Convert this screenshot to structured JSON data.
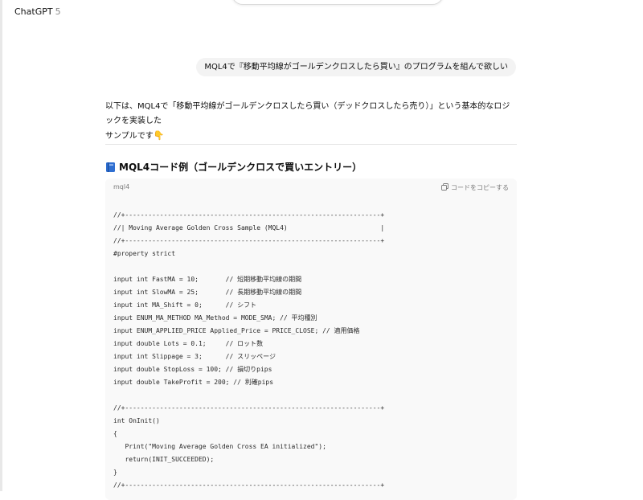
{
  "header": {
    "model_name": "ChatGPT",
    "model_version": "5"
  },
  "conversation": {
    "user_message": "MQL4で『移動平均線がゴールデンクロスしたら買い』のプログラムを組んで欲しい",
    "assistant_intro_line1": "以下は、MQL4で「移動平均線がゴールデンクロスしたら買い（デッドクロスしたら売り）」という基本的なロジックを実装した",
    "assistant_intro_line2": "サンプルです",
    "assistant_emoji": "👇",
    "section_heading": "MQL4コード例（ゴールデンクロスで買いエントリー）",
    "section_icon": "book-icon"
  },
  "code_block": {
    "language": "mql4",
    "copy_label": "コードをコピーする",
    "copy_icon": "copy-icon",
    "lines": [
      "//+------------------------------------------------------------------+",
      "//| Moving Average Golden Cross Sample (MQL4)                        |",
      "//+------------------------------------------------------------------+",
      "#property strict",
      "",
      "input int FastMA = 10;       // 短期移動平均線の期間",
      "input int SlowMA = 25;       // 長期移動平均線の期間",
      "input int MA_Shift = 0;      // シフト",
      "input ENUM_MA_METHOD MA_Method = MODE_SMA; // 平均種別",
      "input ENUM_APPLIED_PRICE Applied_Price = PRICE_CLOSE; // 適用価格",
      "input double Lots = 0.1;     // ロット数",
      "input int Slippage = 3;      // スリッページ",
      "input double StopLoss = 100; // 損切りpips",
      "input double TakeProfit = 200; // 利確pips",
      "",
      "//+------------------------------------------------------------------+",
      "int OnInit()",
      "{",
      "   Print(\"Moving Average Golden Cross EA initialized\");",
      "   return(INIT_SUCCEEDED);",
      "}",
      "//+------------------------------------------------------------------+"
    ]
  }
}
